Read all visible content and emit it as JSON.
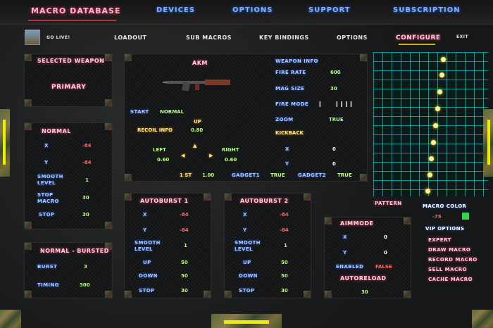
{
  "nav": {
    "title": "MACRO DATABASE",
    "items": [
      "DEVICES",
      "OPTIONS",
      "SUPPORT",
      "SUBSCRIPTION"
    ]
  },
  "sub": {
    "golive": "GO LIVE!",
    "items": [
      "LOADOUT",
      "SUB MACROS",
      "KEY BINDINGS",
      "OPTIONS",
      "CONFIGURE"
    ],
    "exit": "EXIT"
  },
  "selected": {
    "title": "SELECTED WEAPON",
    "value": "PRIMARY"
  },
  "normal": {
    "title": "NORMAL",
    "x_label": "X",
    "x": "-84",
    "y_label": "Y",
    "y": "-84",
    "smooth_label": "SMOOTH LEVEL",
    "smooth": "1",
    "stop_macro_label": "STOP MACRO",
    "stop_macro": "30",
    "stop_label": "STOP",
    "stop": "30"
  },
  "bursted": {
    "title": "NORMAL - BURSTED",
    "burst_label": "BURST",
    "burst": "3",
    "timing_label": "TIMING",
    "timing": "300"
  },
  "weapon": {
    "name": "AKM",
    "start_label": "START",
    "start": "NORMAL",
    "up_label": "UP",
    "recoil_label": "RECOIL INFO",
    "recoil": "0.80",
    "left_label": "LEFT",
    "left": "0.60",
    "right_label": "RIGHT",
    "right": "0.60",
    "first": "1 ST",
    "first_val": "1.00",
    "gadget1": "GADGET1",
    "gadget1_val": "TRUE",
    "gadget2": "GADGET2",
    "gadget2_val": "TRUE"
  },
  "info": {
    "title": "WEAPON INFO",
    "firerate_label": "FIRE RATE",
    "firerate": "600",
    "mag_label": "MAG SIZE",
    "mag": "30",
    "firemode_label": "FIRE MODE",
    "zoom_label": "ZOOM",
    "zoom": "TRUE",
    "kick_label": "KICKBACK",
    "kx_label": "X",
    "kx": "0",
    "ky_label": "Y",
    "ky": "0"
  },
  "auto1": {
    "title": "AUTOBURST 1",
    "x_label": "X",
    "x": "-84",
    "y_label": "Y",
    "y": "-84",
    "smooth_label": "SMOOTH LEVEL",
    "smooth": "1",
    "up_label": "UP",
    "up": "50",
    "down_label": "DOWN",
    "down": "50",
    "stop_label": "STOP",
    "stop": "30"
  },
  "auto2": {
    "title": "AUTOBURST 2",
    "x_label": "X",
    "x": "-84",
    "y_label": "Y",
    "y": "-84",
    "smooth_label": "SMOOTH LEVEL",
    "smooth": "1",
    "up_label": "UP",
    "up": "50",
    "down_label": "DOWN",
    "down": "50",
    "stop_label": "STOP",
    "stop": "30"
  },
  "ammo": {
    "title": "AIMMODE",
    "x_label": "X",
    "x": "0",
    "y_label": "Y",
    "y": "0",
    "enabled_label": "ENABLED",
    "enabled": "FALSE",
    "autoreload_label": "AUTORELOAD",
    "autoreload": "30"
  },
  "pattern": {
    "label": "PATTERN",
    "color_label": "MACRO COLOR",
    "color_val": "-75",
    "color": "#2fd84a"
  },
  "vip": {
    "title": "VIP OPTIONS",
    "items": [
      "EXPERT",
      "DRAW MACRO",
      "RECORD MACRO",
      "SELL MACRO",
      "CACHE MACRO"
    ]
  }
}
